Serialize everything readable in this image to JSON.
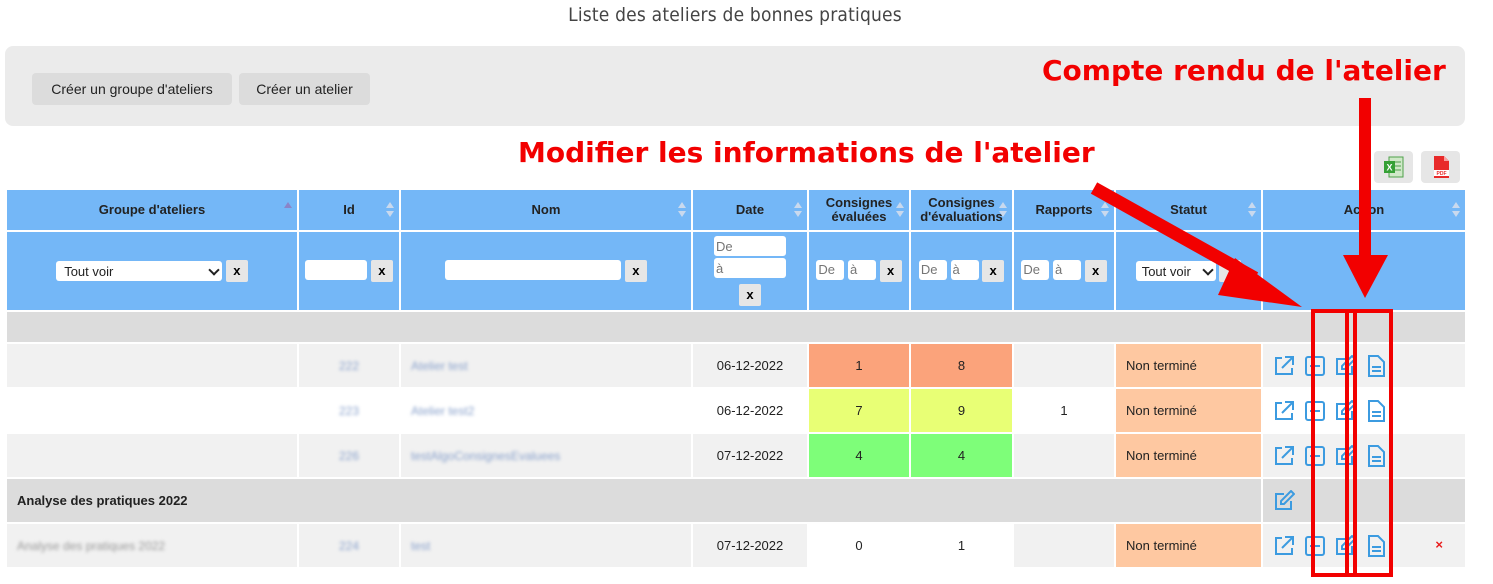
{
  "page_title": "Liste des ateliers de bonnes pratiques",
  "toolbar": {
    "create_group_label": "Créer un groupe d'ateliers",
    "create_workshop_label": "Créer un atelier"
  },
  "exports": {
    "excel_icon": "excel-icon",
    "pdf_icon": "pdf-icon",
    "pdf_label": "PDF"
  },
  "table": {
    "headers": {
      "group": "Groupe d'ateliers",
      "id": "Id",
      "name": "Nom",
      "date": "Date",
      "instr_evaluated_1": "Consignes",
      "instr_evaluated_2": "évaluées",
      "instr_eval_1": "Consignes",
      "instr_eval_2": "d'évaluations",
      "reports": "Rapports",
      "status": "Statut",
      "action": "Action"
    },
    "filters": {
      "group_select": "Tout voir",
      "status_select": "Tout voir",
      "from_placeholder": "De",
      "to_placeholder": "à",
      "clear_label": "x"
    },
    "group_label": "Analyse des pratiques 2022",
    "rows": [
      {
        "group": "",
        "id": "222",
        "name": "Atelier test",
        "date": "06-12-2022",
        "instr_evaluated": "1",
        "instr_eval": "8",
        "reports": "",
        "status": "Non terminé"
      },
      {
        "group": "",
        "id": "223",
        "name": "Atelier test2",
        "date": "06-12-2022",
        "instr_evaluated": "7",
        "instr_eval": "9",
        "reports": "1",
        "status": "Non terminé"
      },
      {
        "group": "",
        "id": "226",
        "name": "testAlgoConsignesEvaluees",
        "date": "07-12-2022",
        "instr_evaluated": "4",
        "instr_eval": "4",
        "reports": "",
        "status": "Non terminé"
      },
      {
        "group": "Analyse des pratiques 2022",
        "id": "224",
        "name": "test",
        "date": "07-12-2022",
        "instr_evaluated": "0",
        "instr_eval": "1",
        "reports": "",
        "status": "Non terminé"
      }
    ],
    "delete_label": "×"
  },
  "annotations": {
    "report_label": "Compte rendu de l'atelier",
    "edit_label": "Modifier les informations de l'atelier",
    "color": "#f20000"
  },
  "colors": {
    "header_blue": "#74b7f7",
    "icon_blue": "#3c9be0",
    "low_score": "#fba37b",
    "mid_score": "#e8ff75",
    "high_score": "#7efe79",
    "status_bg": "#fec8a1"
  }
}
